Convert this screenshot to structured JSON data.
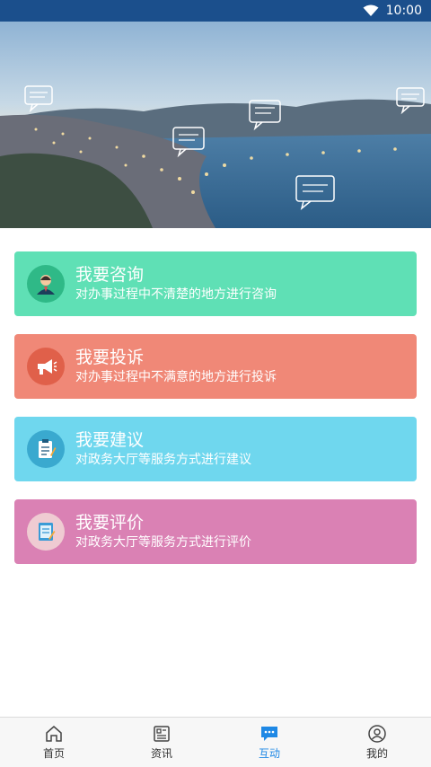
{
  "status_bar": {
    "time": "10:00"
  },
  "cards": [
    {
      "title": "我要咨询",
      "subtitle": "对办事过程中不清楚的地方进行咨询",
      "color": "#5fe0b5"
    },
    {
      "title": "我要投诉",
      "subtitle": "对办事过程中不满意的地方进行投诉",
      "color": "#f08877"
    },
    {
      "title": "我要建议",
      "subtitle": "对政务大厅等服务方式进行建议",
      "color": "#6fd7ee"
    },
    {
      "title": "我要评价",
      "subtitle": "对政务大厅等服务方式进行评价",
      "color": "#da81b4"
    }
  ],
  "tabbar": {
    "items": [
      {
        "label": "首页",
        "icon": "home-icon",
        "active": false
      },
      {
        "label": "资讯",
        "icon": "news-icon",
        "active": false
      },
      {
        "label": "互动",
        "icon": "chat-icon",
        "active": true
      },
      {
        "label": "我的",
        "icon": "user-icon",
        "active": false
      }
    ],
    "active_color": "#1e88e5"
  }
}
